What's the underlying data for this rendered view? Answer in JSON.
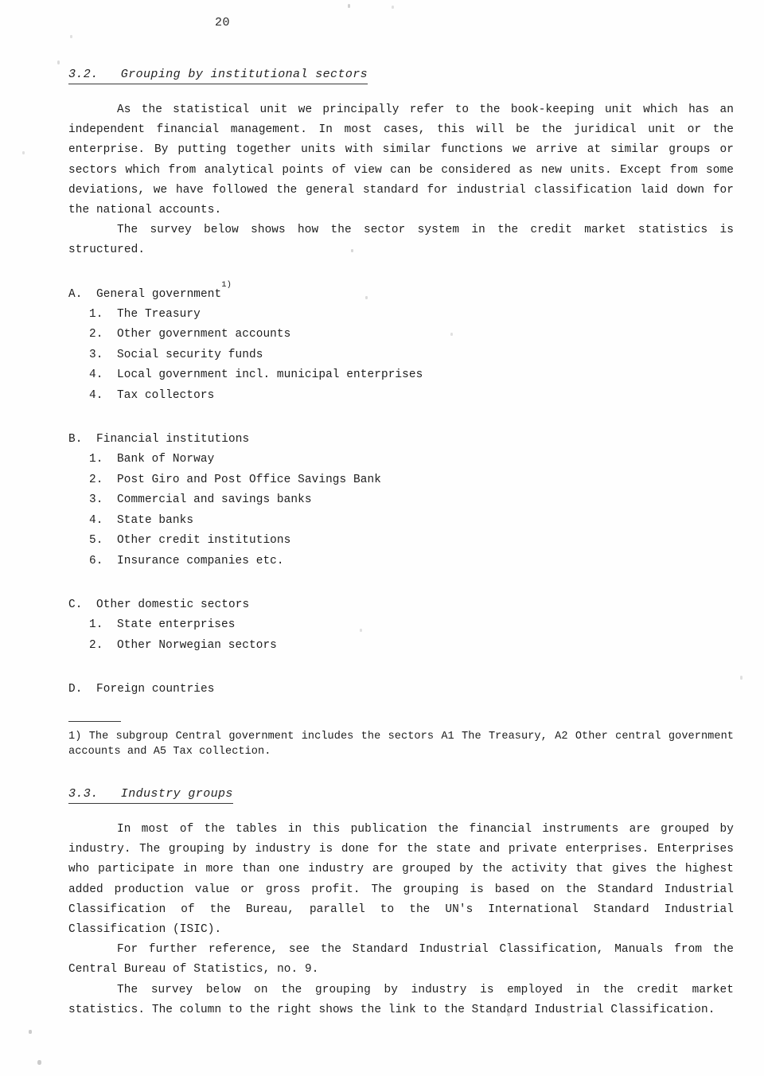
{
  "page": {
    "number": "20"
  },
  "sections": {
    "institutional": {
      "heading": "3.2.   Grouping by institutional sectors",
      "intro_paragraph": "As the statistical unit we principally refer to the book-keeping unit which has an independent financial management.  In most cases, this will be the juridical unit or the enterprise.  By putting together units with similar functions we arrive at similar groups or sectors which from analytical points of view can be considered as new units.  Except from some deviations, we have followed the general standard for industrial classification laid down for the national accounts.",
      "survey_paragraph": "The survey below shows how the sector system in the credit market statistics is structured.",
      "groups": [
        {
          "letter": "A.",
          "title": "General government",
          "superscript": "1)",
          "items": [
            {
              "num": "1.",
              "label": "The Treasury"
            },
            {
              "num": "2.",
              "label": "Other government accounts"
            },
            {
              "num": "3.",
              "label": "Social security funds"
            },
            {
              "num": "4.",
              "label": "Local government incl. municipal enterprises"
            },
            {
              "num": "4.",
              "label": "Tax collectors"
            }
          ]
        },
        {
          "letter": "B.",
          "title": "Financial institutions",
          "superscript": "",
          "items": [
            {
              "num": "1.",
              "label": "Bank of Norway"
            },
            {
              "num": "2.",
              "label": "Post Giro and Post Office Savings Bank"
            },
            {
              "num": "3.",
              "label": "Commercial and savings banks"
            },
            {
              "num": "4.",
              "label": "State banks"
            },
            {
              "num": "5.",
              "label": "Other credit institutions"
            },
            {
              "num": "6.",
              "label": "Insurance companies etc."
            }
          ]
        },
        {
          "letter": "C.",
          "title": "Other domestic sectors",
          "superscript": "",
          "items": [
            {
              "num": "1.",
              "label": "State enterprises"
            },
            {
              "num": "2.",
              "label": "Other Norwegian sectors"
            }
          ]
        },
        {
          "letter": "D.",
          "title": "Foreign countries",
          "superscript": "",
          "items": []
        }
      ],
      "footnote": "1) The subgroup Central government includes the sectors A1 The Treasury, A2 Other central government accounts and A5 Tax collection."
    },
    "industry": {
      "heading": "3.3.   Industry groups",
      "paragraph_1": "In most of the tables in this publication the financial instruments are grouped by industry. The grouping by industry is done for the state and private enterprises.  Enterprises who participate in more than one industry are grouped by the activity that gives the highest added production value or gross profit.  The grouping is based on the Standard Industrial Classification of the Bureau, parallel to the UN's International Standard Industrial Classification (ISIC).",
      "paragraph_2": "For further reference, see the Standard Industrial Classification, Manuals from the Central Bureau of Statistics, no. 9.",
      "paragraph_3": "The survey below on the grouping by industry is employed in the credit market statistics. The column to the right shows the link to the Standard Industrial Classification."
    }
  }
}
